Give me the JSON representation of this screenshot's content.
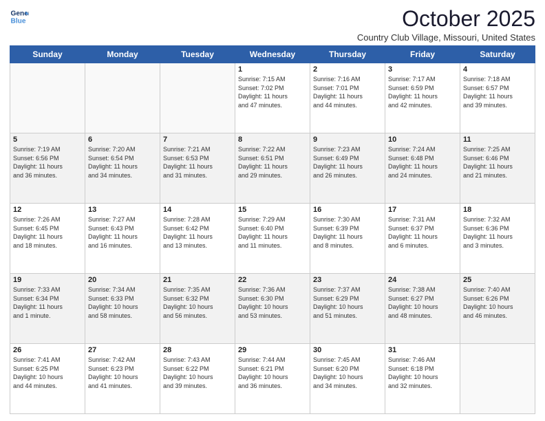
{
  "logo": {
    "line1": "General",
    "line2": "Blue"
  },
  "title": "October 2025",
  "subtitle": "Country Club Village, Missouri, United States",
  "days_of_week": [
    "Sunday",
    "Monday",
    "Tuesday",
    "Wednesday",
    "Thursday",
    "Friday",
    "Saturday"
  ],
  "weeks": [
    [
      {
        "num": "",
        "info": ""
      },
      {
        "num": "",
        "info": ""
      },
      {
        "num": "",
        "info": ""
      },
      {
        "num": "1",
        "info": "Sunrise: 7:15 AM\nSunset: 7:02 PM\nDaylight: 11 hours\nand 47 minutes."
      },
      {
        "num": "2",
        "info": "Sunrise: 7:16 AM\nSunset: 7:01 PM\nDaylight: 11 hours\nand 44 minutes."
      },
      {
        "num": "3",
        "info": "Sunrise: 7:17 AM\nSunset: 6:59 PM\nDaylight: 11 hours\nand 42 minutes."
      },
      {
        "num": "4",
        "info": "Sunrise: 7:18 AM\nSunset: 6:57 PM\nDaylight: 11 hours\nand 39 minutes."
      }
    ],
    [
      {
        "num": "5",
        "info": "Sunrise: 7:19 AM\nSunset: 6:56 PM\nDaylight: 11 hours\nand 36 minutes."
      },
      {
        "num": "6",
        "info": "Sunrise: 7:20 AM\nSunset: 6:54 PM\nDaylight: 11 hours\nand 34 minutes."
      },
      {
        "num": "7",
        "info": "Sunrise: 7:21 AM\nSunset: 6:53 PM\nDaylight: 11 hours\nand 31 minutes."
      },
      {
        "num": "8",
        "info": "Sunrise: 7:22 AM\nSunset: 6:51 PM\nDaylight: 11 hours\nand 29 minutes."
      },
      {
        "num": "9",
        "info": "Sunrise: 7:23 AM\nSunset: 6:49 PM\nDaylight: 11 hours\nand 26 minutes."
      },
      {
        "num": "10",
        "info": "Sunrise: 7:24 AM\nSunset: 6:48 PM\nDaylight: 11 hours\nand 24 minutes."
      },
      {
        "num": "11",
        "info": "Sunrise: 7:25 AM\nSunset: 6:46 PM\nDaylight: 11 hours\nand 21 minutes."
      }
    ],
    [
      {
        "num": "12",
        "info": "Sunrise: 7:26 AM\nSunset: 6:45 PM\nDaylight: 11 hours\nand 18 minutes."
      },
      {
        "num": "13",
        "info": "Sunrise: 7:27 AM\nSunset: 6:43 PM\nDaylight: 11 hours\nand 16 minutes."
      },
      {
        "num": "14",
        "info": "Sunrise: 7:28 AM\nSunset: 6:42 PM\nDaylight: 11 hours\nand 13 minutes."
      },
      {
        "num": "15",
        "info": "Sunrise: 7:29 AM\nSunset: 6:40 PM\nDaylight: 11 hours\nand 11 minutes."
      },
      {
        "num": "16",
        "info": "Sunrise: 7:30 AM\nSunset: 6:39 PM\nDaylight: 11 hours\nand 8 minutes."
      },
      {
        "num": "17",
        "info": "Sunrise: 7:31 AM\nSunset: 6:37 PM\nDaylight: 11 hours\nand 6 minutes."
      },
      {
        "num": "18",
        "info": "Sunrise: 7:32 AM\nSunset: 6:36 PM\nDaylight: 11 hours\nand 3 minutes."
      }
    ],
    [
      {
        "num": "19",
        "info": "Sunrise: 7:33 AM\nSunset: 6:34 PM\nDaylight: 11 hours\nand 1 minute."
      },
      {
        "num": "20",
        "info": "Sunrise: 7:34 AM\nSunset: 6:33 PM\nDaylight: 10 hours\nand 58 minutes."
      },
      {
        "num": "21",
        "info": "Sunrise: 7:35 AM\nSunset: 6:32 PM\nDaylight: 10 hours\nand 56 minutes."
      },
      {
        "num": "22",
        "info": "Sunrise: 7:36 AM\nSunset: 6:30 PM\nDaylight: 10 hours\nand 53 minutes."
      },
      {
        "num": "23",
        "info": "Sunrise: 7:37 AM\nSunset: 6:29 PM\nDaylight: 10 hours\nand 51 minutes."
      },
      {
        "num": "24",
        "info": "Sunrise: 7:38 AM\nSunset: 6:27 PM\nDaylight: 10 hours\nand 48 minutes."
      },
      {
        "num": "25",
        "info": "Sunrise: 7:40 AM\nSunset: 6:26 PM\nDaylight: 10 hours\nand 46 minutes."
      }
    ],
    [
      {
        "num": "26",
        "info": "Sunrise: 7:41 AM\nSunset: 6:25 PM\nDaylight: 10 hours\nand 44 minutes."
      },
      {
        "num": "27",
        "info": "Sunrise: 7:42 AM\nSunset: 6:23 PM\nDaylight: 10 hours\nand 41 minutes."
      },
      {
        "num": "28",
        "info": "Sunrise: 7:43 AM\nSunset: 6:22 PM\nDaylight: 10 hours\nand 39 minutes."
      },
      {
        "num": "29",
        "info": "Sunrise: 7:44 AM\nSunset: 6:21 PM\nDaylight: 10 hours\nand 36 minutes."
      },
      {
        "num": "30",
        "info": "Sunrise: 7:45 AM\nSunset: 6:20 PM\nDaylight: 10 hours\nand 34 minutes."
      },
      {
        "num": "31",
        "info": "Sunrise: 7:46 AM\nSunset: 6:18 PM\nDaylight: 10 hours\nand 32 minutes."
      },
      {
        "num": "",
        "info": ""
      }
    ]
  ]
}
